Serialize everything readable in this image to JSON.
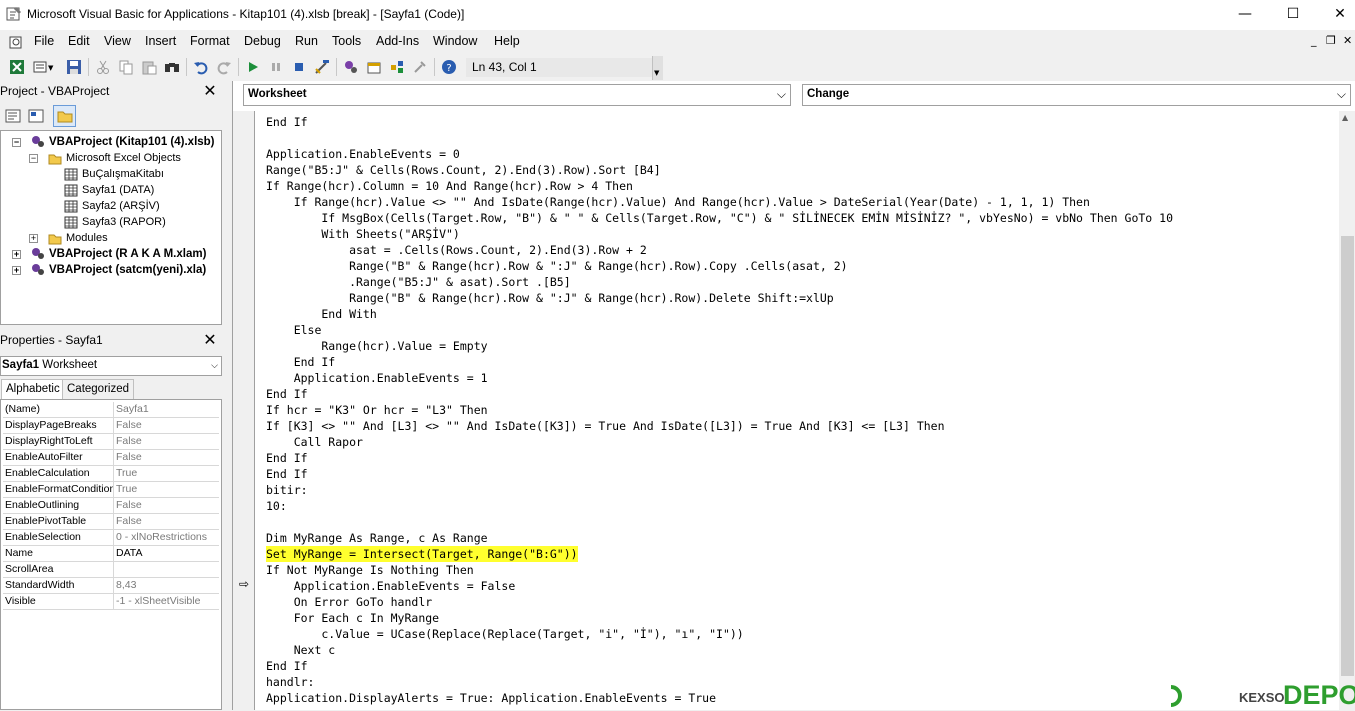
{
  "window": {
    "title": "Microsoft Visual Basic for Applications - Kitap101 (4).xlsb [break] - [Sayfa1 (Code)]",
    "minimize_glyph": "—",
    "maximize_glyph": "☐",
    "close_glyph": "✕"
  },
  "menu": {
    "items": [
      "File",
      "Edit",
      "View",
      "Insert",
      "Format",
      "Debug",
      "Run",
      "Tools",
      "Add-Ins",
      "Window",
      "Help"
    ],
    "mdi_min": "_",
    "mdi_restore": "❐",
    "mdi_close": "✕"
  },
  "toolbar": {
    "position_text": "Ln 43, Col 1",
    "icons": [
      "excel-icon",
      "insert-module-icon",
      "save-icon",
      "cut-icon",
      "copy-icon",
      "paste-icon",
      "find-icon",
      "undo-icon",
      "redo-icon",
      "run-icon",
      "break-icon",
      "reset-icon",
      "design-mode-icon",
      "project-explorer-icon",
      "properties-icon",
      "object-browser-icon",
      "toolbox-icon",
      "help-icon"
    ]
  },
  "project_pane": {
    "title": "Project - VBAProject",
    "close_glyph": "✕",
    "tree": [
      {
        "label": "VBAProject (Kitap101 (4).xlsb)",
        "level": 0,
        "bold": true,
        "expander": "−"
      },
      {
        "label": "Microsoft Excel Objects",
        "level": 1,
        "bold": false,
        "expander": "−"
      },
      {
        "label": "BuÇalışmaKitabı",
        "level": 2,
        "bold": false,
        "expander": ""
      },
      {
        "label": "Sayfa1 (DATA)",
        "level": 2,
        "bold": false,
        "expander": ""
      },
      {
        "label": "Sayfa2 (ARŞİV)",
        "level": 2,
        "bold": false,
        "expander": ""
      },
      {
        "label": "Sayfa3 (RAPOR)",
        "level": 2,
        "bold": false,
        "expander": ""
      },
      {
        "label": "Modules",
        "level": 1,
        "bold": false,
        "expander": "+"
      },
      {
        "label": "VBAProject (R A K A M.xlam)",
        "level": 0,
        "bold": true,
        "expander": "+"
      },
      {
        "label": "VBAProject (satcm(yeni).xla)",
        "level": 0,
        "bold": true,
        "expander": "+"
      }
    ]
  },
  "properties_pane": {
    "title": "Properties - Sayfa1",
    "close_glyph": "✕",
    "object_name": "Sayfa1",
    "object_type": "Worksheet",
    "tabs": [
      "Alphabetic",
      "Categorized"
    ],
    "rows": [
      {
        "name": "(Name)",
        "value": "Sayfa1",
        "dark": false
      },
      {
        "name": "DisplayPageBreaks",
        "value": "False",
        "dark": false
      },
      {
        "name": "DisplayRightToLeft",
        "value": "False",
        "dark": false
      },
      {
        "name": "EnableAutoFilter",
        "value": "False",
        "dark": false
      },
      {
        "name": "EnableCalculation",
        "value": "True",
        "dark": false
      },
      {
        "name": "EnableFormatConditionsCalculation",
        "value": "True",
        "dark": false
      },
      {
        "name": "EnableOutlining",
        "value": "False",
        "dark": false
      },
      {
        "name": "EnablePivotTable",
        "value": "False",
        "dark": false
      },
      {
        "name": "EnableSelection",
        "value": "0 - xlNoRestrictions",
        "dark": false
      },
      {
        "name": "Name",
        "value": "DATA",
        "dark": true
      },
      {
        "name": "ScrollArea",
        "value": "",
        "dark": false
      },
      {
        "name": "StandardWidth",
        "value": "8,43",
        "dark": false
      },
      {
        "name": "Visible",
        "value": "-1 - xlSheetVisible",
        "dark": false
      }
    ]
  },
  "code_window": {
    "object_combo": "Worksheet",
    "procedure_combo": "Change",
    "combo_arrow": "⌵",
    "exec_arrow": "⇨",
    "lines": [
      {
        "text": "End If",
        "hl": false
      },
      {
        "text": "",
        "hl": false
      },
      {
        "text": "Application.EnableEvents = 0",
        "hl": false
      },
      {
        "text": "Range(\"B5:J\" & Cells(Rows.Count, 2).End(3).Row).Sort [B4]",
        "hl": false
      },
      {
        "text": "If Range(hcr).Column = 10 And Range(hcr).Row > 4 Then",
        "hl": false
      },
      {
        "text": "    If Range(hcr).Value <> \"\" And IsDate(Range(hcr).Value) And Range(hcr).Value > DateSerial(Year(Date) - 1, 1, 1) Then",
        "hl": false
      },
      {
        "text": "        If MsgBox(Cells(Target.Row, \"B\") & \" \" & Cells(Target.Row, \"C\") & \" SİLİNECEK EMİN MİSİNİZ? \", vbYesNo) = vbNo Then GoTo 10",
        "hl": false
      },
      {
        "text": "        With Sheets(\"ARŞİV\")",
        "hl": false
      },
      {
        "text": "            asat = .Cells(Rows.Count, 2).End(3).Row + 2",
        "hl": false
      },
      {
        "text": "            Range(\"B\" & Range(hcr).Row & \":J\" & Range(hcr).Row).Copy .Cells(asat, 2)",
        "hl": false
      },
      {
        "text": "            .Range(\"B5:J\" & asat).Sort .[B5]",
        "hl": false
      },
      {
        "text": "            Range(\"B\" & Range(hcr).Row & \":J\" & Range(hcr).Row).Delete Shift:=xlUp",
        "hl": false
      },
      {
        "text": "        End With",
        "hl": false
      },
      {
        "text": "    Else",
        "hl": false
      },
      {
        "text": "        Range(hcr).Value = Empty",
        "hl": false
      },
      {
        "text": "    End If",
        "hl": false
      },
      {
        "text": "    Application.EnableEvents = 1",
        "hl": false
      },
      {
        "text": "End If",
        "hl": false
      },
      {
        "text": "If hcr = \"K3\" Or hcr = \"L3\" Then",
        "hl": false
      },
      {
        "text": "If [K3] <> \"\" And [L3] <> \"\" And IsDate([K3]) = True And IsDate([L3]) = True And [K3] <= [L3] Then",
        "hl": false
      },
      {
        "text": "    Call Rapor",
        "hl": false
      },
      {
        "text": "End If",
        "hl": false
      },
      {
        "text": "End If",
        "hl": false
      },
      {
        "text": "bitir:",
        "hl": false
      },
      {
        "text": "10:",
        "hl": false
      },
      {
        "text": "",
        "hl": false
      },
      {
        "text": "Dim MyRange As Range, c As Range",
        "hl": false
      },
      {
        "text": "Set MyRange = Intersect(Target, Range(\"B:G\"))",
        "hl": true
      },
      {
        "text": "If Not MyRange Is Nothing Then",
        "hl": false
      },
      {
        "text": "    Application.EnableEvents = False",
        "hl": false
      },
      {
        "text": "    On Error GoTo handlr",
        "hl": false
      },
      {
        "text": "    For Each c In MyRange",
        "hl": false
      },
      {
        "text": "        c.Value = UCase(Replace(Replace(Target, \"i\", \"İ\"), \"ı\", \"I\"))",
        "hl": false
      },
      {
        "text": "    Next c",
        "hl": false
      },
      {
        "text": "End If",
        "hl": false
      },
      {
        "text": "handlr:",
        "hl": false
      },
      {
        "text": "Application.DisplayAlerts = True: Application.EnableEvents = True",
        "hl": false
      }
    ]
  },
  "watermark": {
    "text": "DEPO",
    "prefix": "KEXSO",
    "color": "#2e9e2e"
  }
}
